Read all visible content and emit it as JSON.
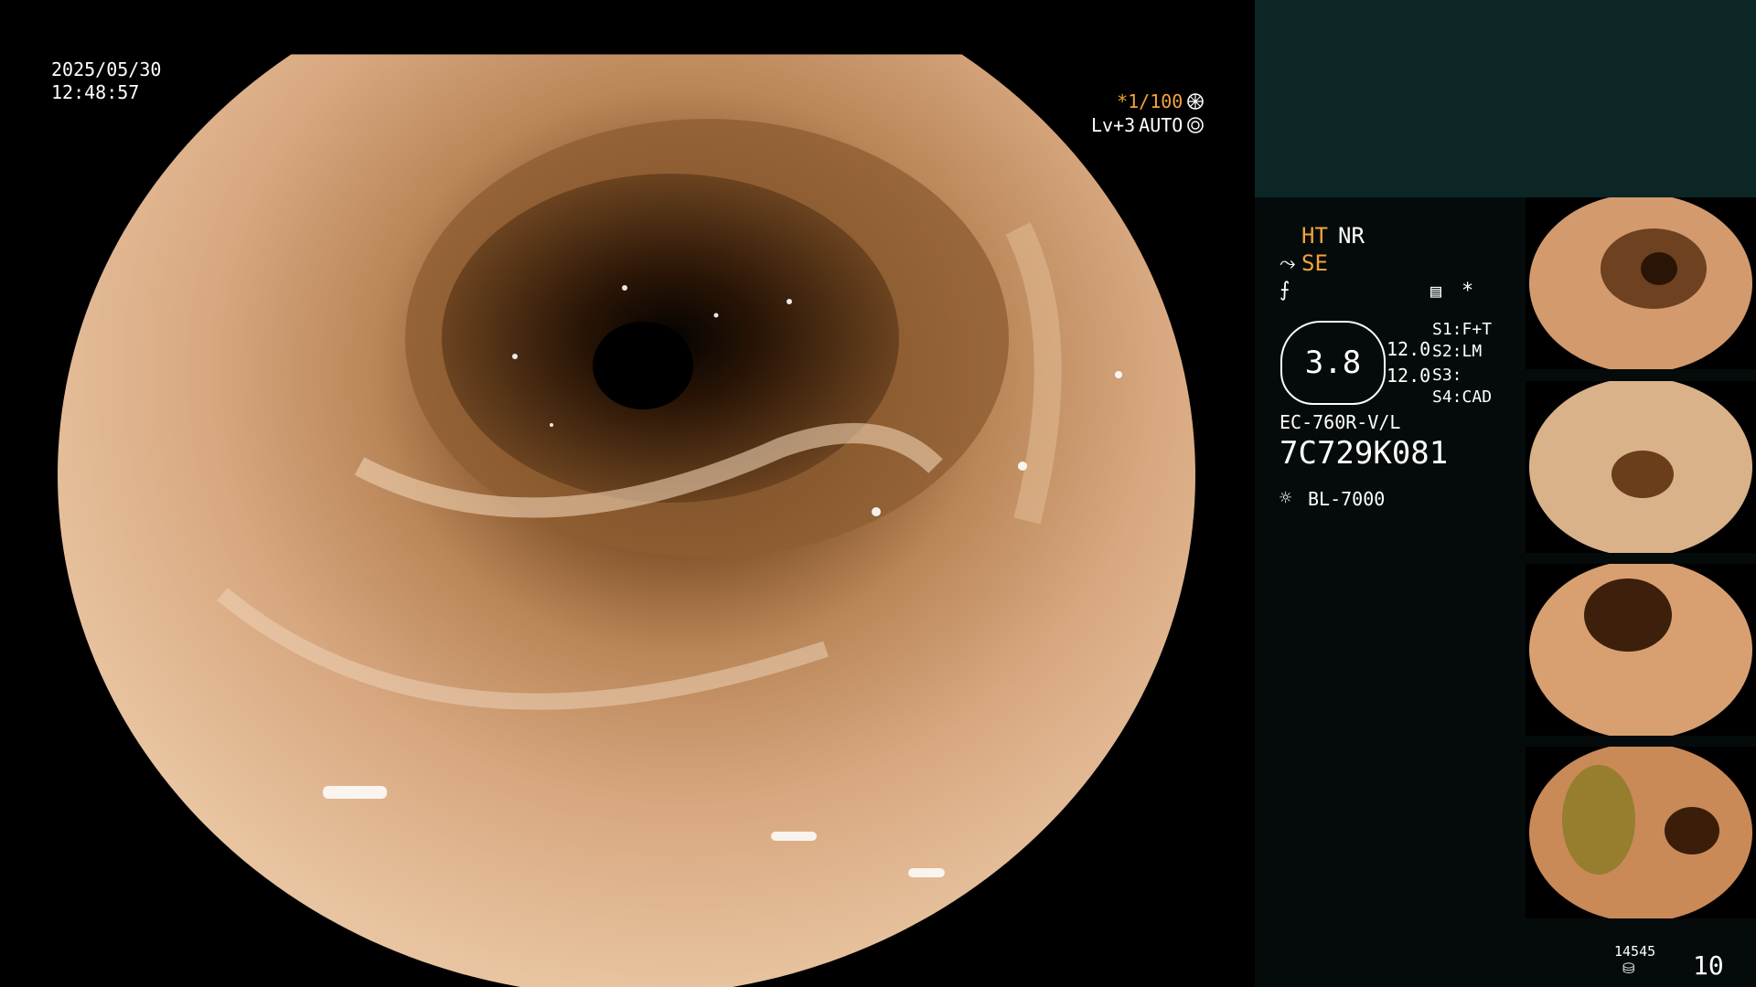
{
  "overlay": {
    "date": "2025/05/30",
    "time": "12:48:57",
    "shutter": "*1/100",
    "level": "Lv+3",
    "mode": "AUTO"
  },
  "side": {
    "ht": "HT",
    "nr": "NR",
    "se": "SE",
    "settings_star": "*",
    "scope_value": "3.8",
    "values": [
      "12.0",
      "12.0"
    ],
    "switches": [
      {
        "key": "S1:",
        "val": "F+T"
      },
      {
        "key": "S2:",
        "val": "LM"
      },
      {
        "key": "S3:",
        "val": ""
      },
      {
        "key": "S4:",
        "val": "CAD"
      }
    ],
    "model": "EC-760R-V/L",
    "serial": "7C729K081",
    "light_source": "BL-7000"
  },
  "footer": {
    "count_small": "14545",
    "count_big": "10"
  },
  "colors": {
    "accent": "#f2a33a",
    "panel_top": "#0c2626",
    "panel": "#050b0b"
  }
}
